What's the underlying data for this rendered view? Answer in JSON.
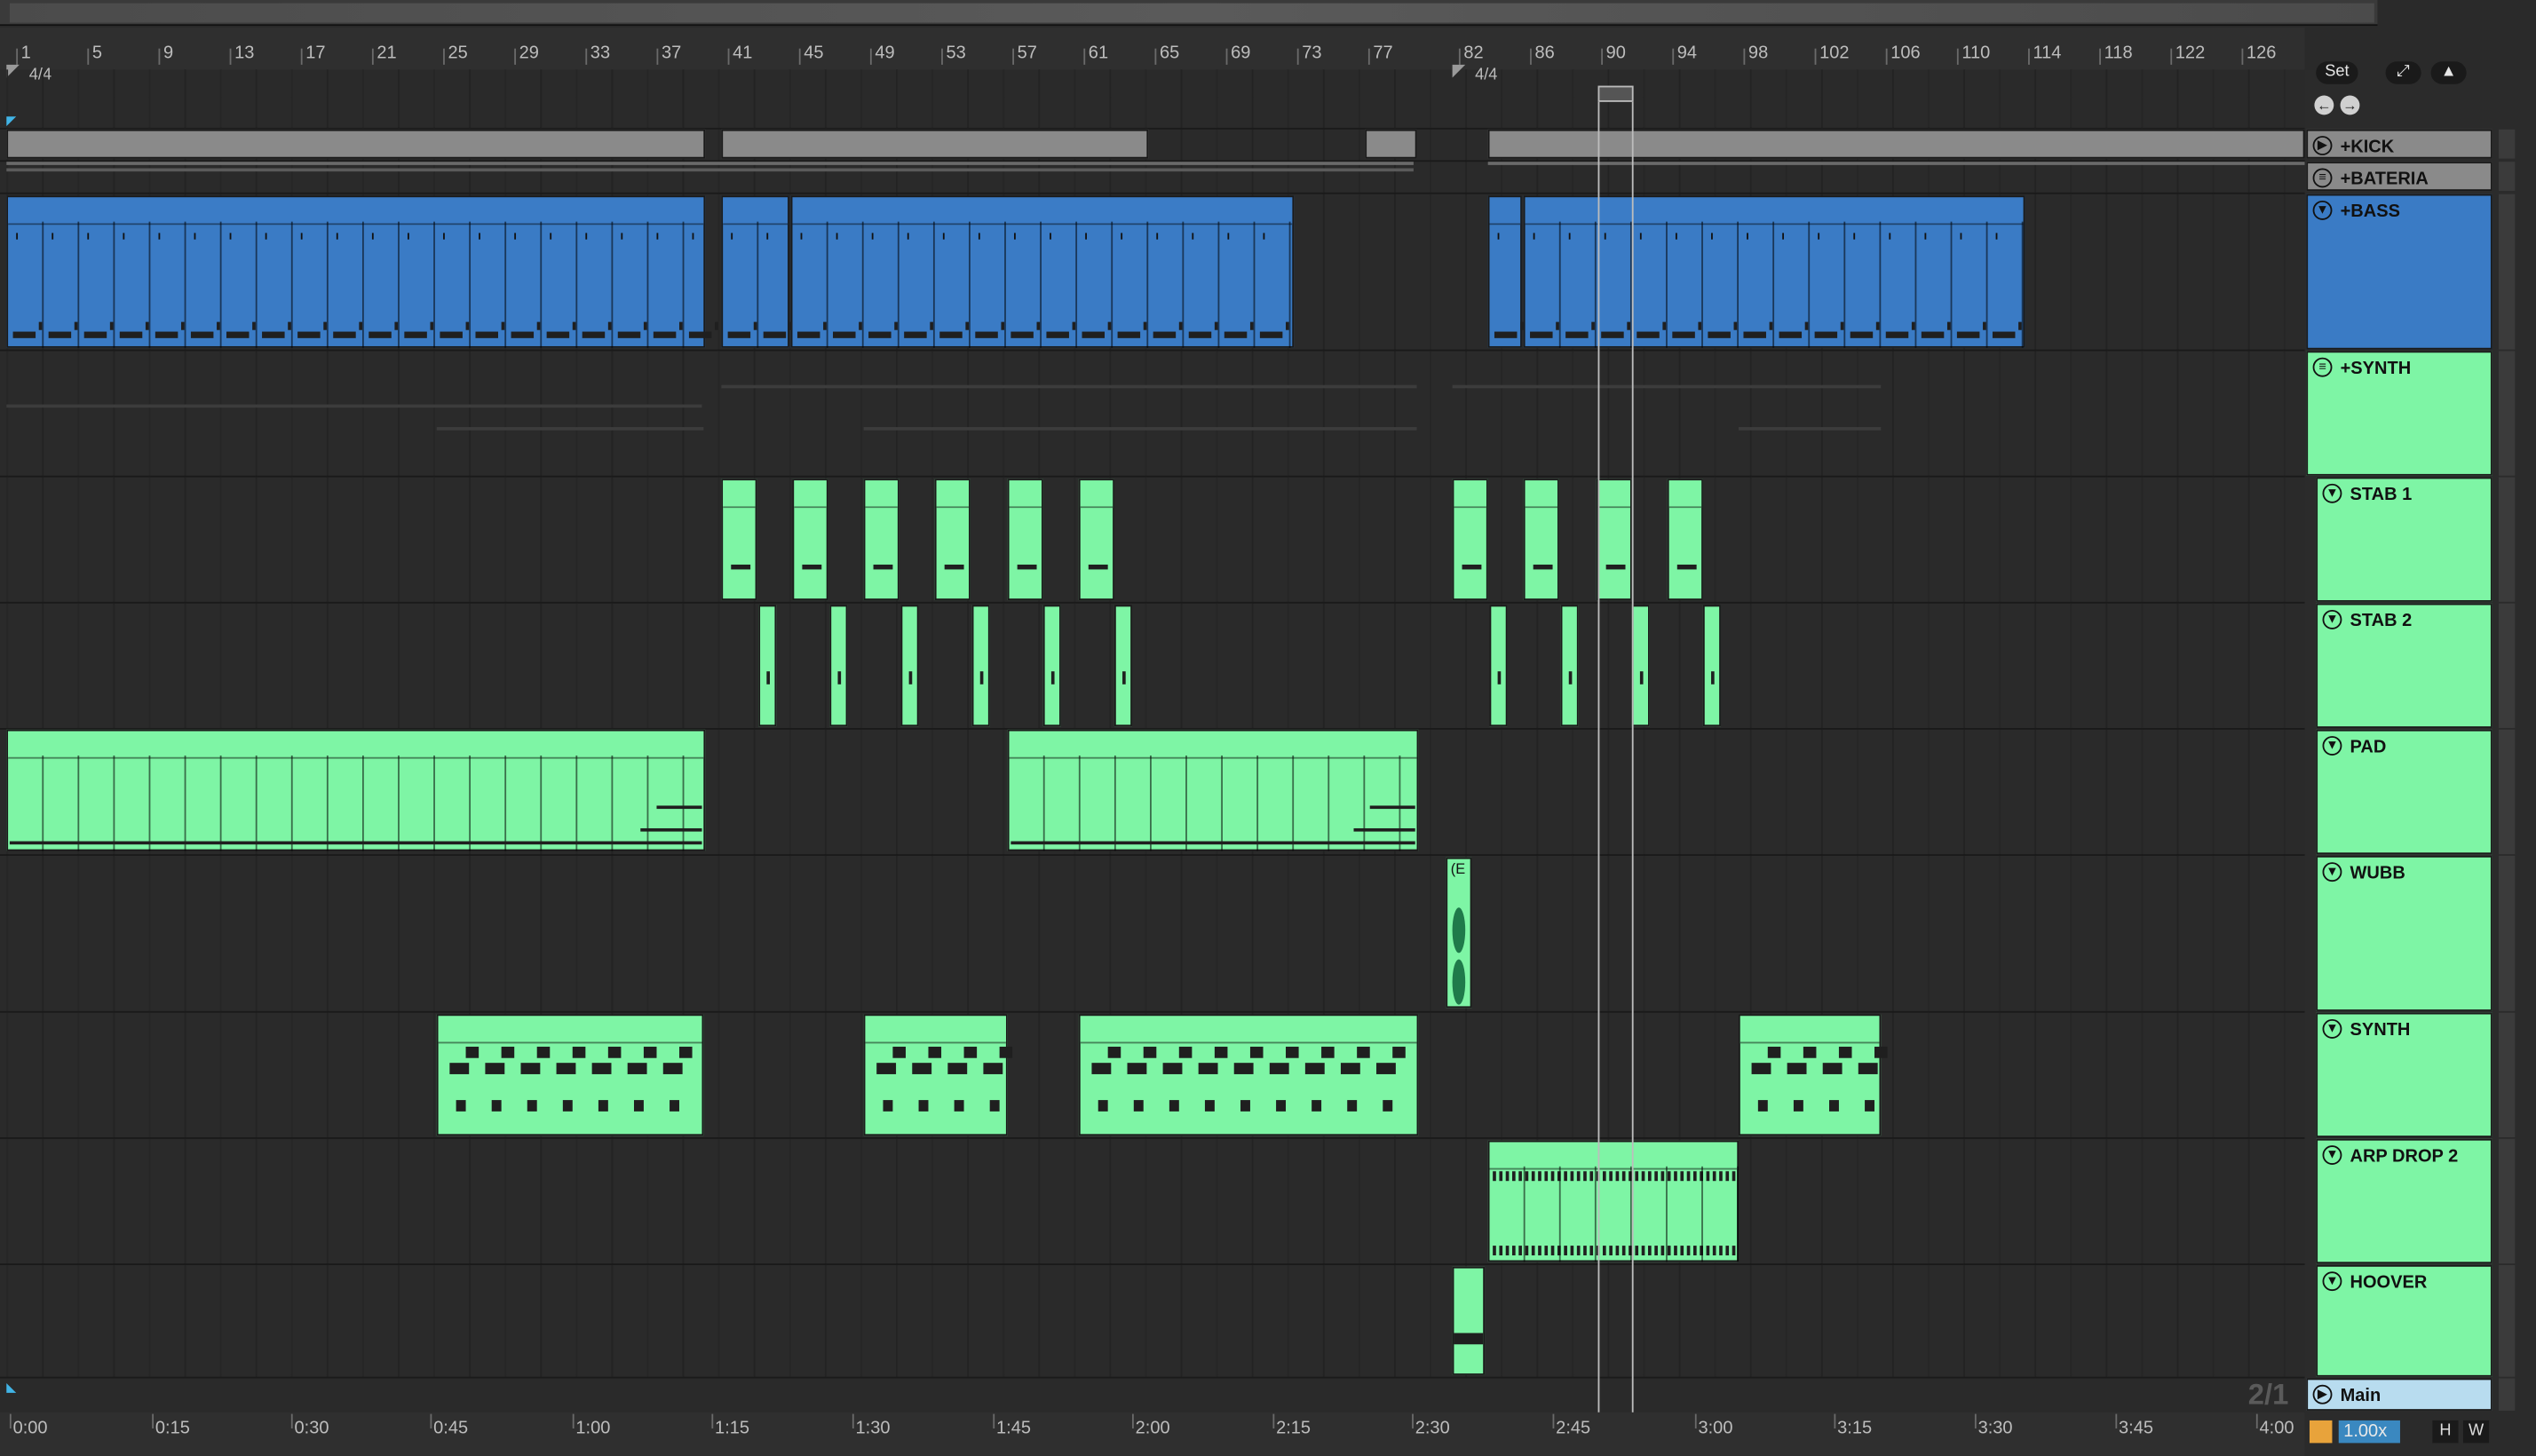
{
  "ruler": {
    "bars": [
      "1",
      "5",
      "9",
      "13",
      "17",
      "21",
      "25",
      "29",
      "33",
      "37",
      "41",
      "45",
      "49",
      "53",
      "57",
      "61",
      "65",
      "69",
      "73",
      "77",
      "82",
      "86",
      "90",
      "94",
      "98",
      "102",
      "106",
      "110",
      "114",
      "118",
      "122",
      "126"
    ],
    "time_signatures": [
      "4/4",
      "4/4"
    ]
  },
  "controls": {
    "set_label": "Set",
    "expand_icon": "expand-icon",
    "lock_icon": "lock-icon",
    "back_icon": "arrow-left-icon",
    "forward_icon": "arrow-right-icon"
  },
  "tracks": [
    {
      "name": "+KICK",
      "color": "#8a8a8a",
      "icon": "play-icon"
    },
    {
      "name": "+BATERIA",
      "color": "#8a8a8a",
      "icon": "menu-icon"
    },
    {
      "name": "+BASS",
      "color": "#3a7bc5",
      "icon": "chevron-down-icon"
    },
    {
      "name": "+SYNTH",
      "color": "#7ef5a5",
      "icon": "menu-icon"
    },
    {
      "name": "STAB 1",
      "color": "#7ef5a5",
      "icon": "chevron-down-icon"
    },
    {
      "name": "STAB 2",
      "color": "#7ef5a5",
      "icon": "chevron-down-icon"
    },
    {
      "name": "PAD",
      "color": "#7ef5a5",
      "icon": "chevron-down-icon"
    },
    {
      "name": "WUBB",
      "color": "#7ef5a5",
      "icon": "chevron-down-icon"
    },
    {
      "name": "SYNTH",
      "color": "#7ef5a5",
      "icon": "chevron-down-icon"
    },
    {
      "name": "ARP DROP 2",
      "color": "#7ef5a5",
      "icon": "chevron-down-icon"
    },
    {
      "name": "HOOVER",
      "color": "#7ef5a5",
      "icon": "chevron-down-icon"
    }
  ],
  "main_track": {
    "name": "Main",
    "color": "#b8dcef"
  },
  "timeline": {
    "labels": [
      "0:00",
      "0:15",
      "0:30",
      "0:45",
      "1:00",
      "1:15",
      "1:30",
      "1:45",
      "2:00",
      "2:15",
      "2:30",
      "2:45",
      "3:00",
      "3:15",
      "3:30",
      "3:45",
      "4:00"
    ]
  },
  "grid_display": "2/1",
  "tempo_factor": "1.00x",
  "h_label": "H",
  "w_label": "W",
  "wubb_clip_label": "(E"
}
